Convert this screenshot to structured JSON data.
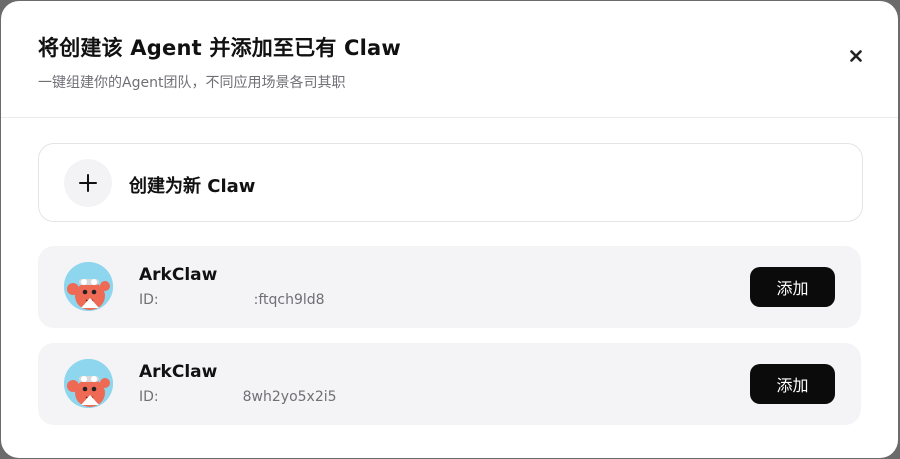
{
  "dialog": {
    "title": "将创建该 Agent 并添加至已有 Claw",
    "subtitle": "一键组建你的Agent团队，不同应用场景各司其职",
    "close_icon": "×"
  },
  "create_new": {
    "label": "创建为新 Claw"
  },
  "claws": [
    {
      "name": "ArkClaw",
      "id_prefix": "ID:",
      "id_suffix": ":ftqch9ld8",
      "add_label": "添加"
    },
    {
      "name": "ArkClaw",
      "id_prefix": "ID:",
      "id_suffix": "8wh2yo5x2i5",
      "add_label": "添加"
    }
  ],
  "colors": {
    "primary_button": "#0b0b0b",
    "row_background": "#f4f4f6",
    "avatar_background": "#8ed6ee",
    "mascot": "#ee6a55"
  }
}
